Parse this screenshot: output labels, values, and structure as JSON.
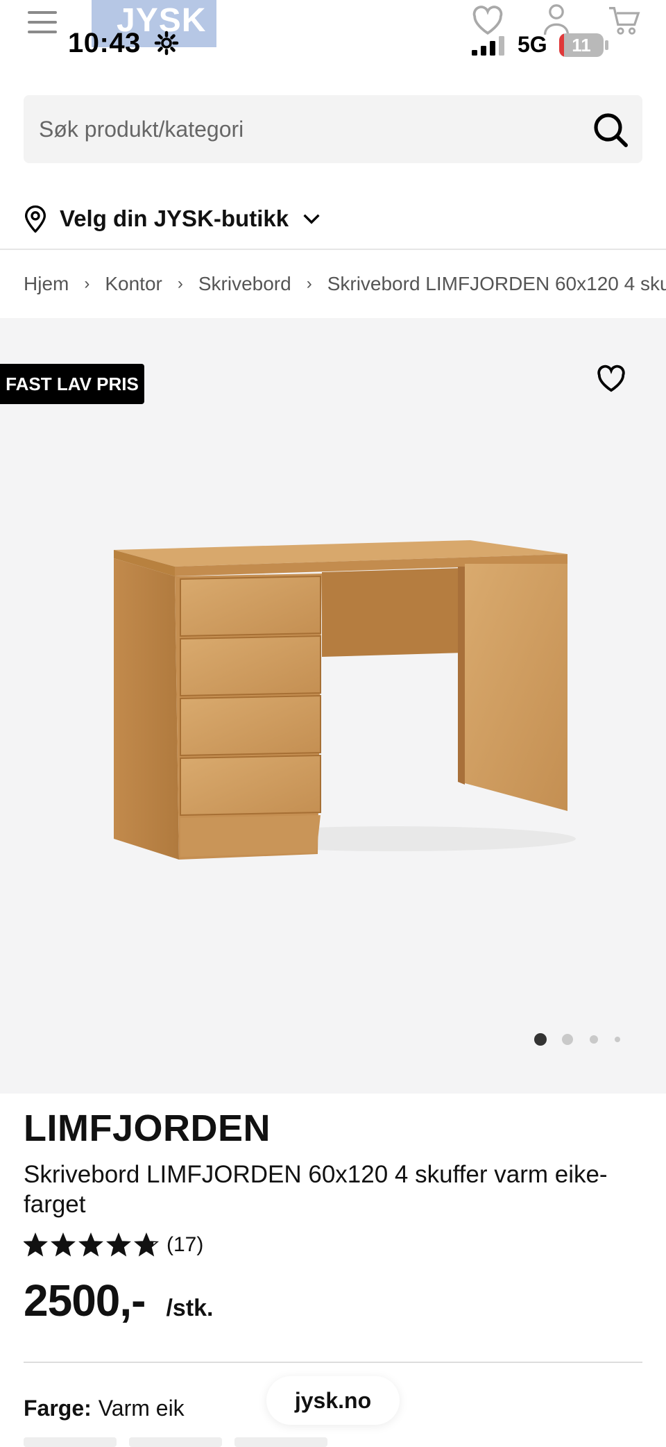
{
  "status_bar": {
    "time": "10:43",
    "network": "5G",
    "battery": "11",
    "battery_level": 0.11
  },
  "header": {
    "logo_text": "JYSK",
    "icons": [
      "menu-icon",
      "heart-icon",
      "user-icon",
      "cart-icon"
    ]
  },
  "search": {
    "placeholder": "Søk produkt/kategori",
    "value": ""
  },
  "store": {
    "label": "Velg din JYSK-butikk"
  },
  "breadcrumb": {
    "items": [
      "Hjem",
      "Kontor",
      "Skrivebord",
      "Skrivebord LIMFJORDEN 60x120 4 sku"
    ]
  },
  "gallery": {
    "badge": "FAST LAV PRIS",
    "image_count": 4,
    "active_index": 0
  },
  "product": {
    "brand": "LIMFJORDEN",
    "name": "Skrivebord LIMFJORDEN 60x120 4 skuffer varm eike-farget",
    "rating": 4.8,
    "rating_max": 5,
    "review_count": "(17)",
    "price": "2500,-",
    "unit": "/stk.",
    "color_label": "Farge:",
    "color_value": "Varm eik"
  },
  "browser": {
    "domain": "jysk.no"
  },
  "colors": {
    "accent": "#000000",
    "gallery_bg": "#f4f4f5",
    "search_bg": "#f3f3f3",
    "battery_low": "#e0393a"
  }
}
